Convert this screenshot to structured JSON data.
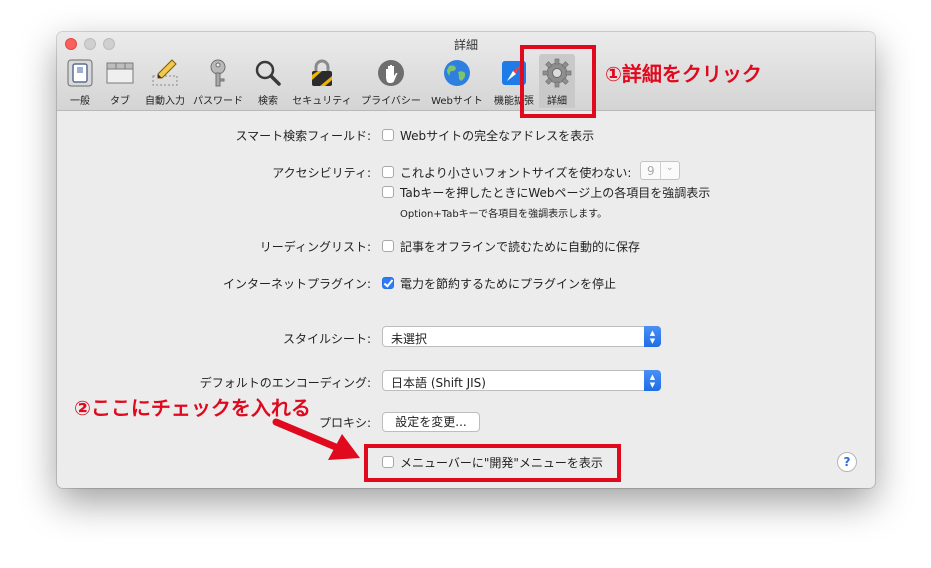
{
  "window": {
    "title": "詳細"
  },
  "toolbar": {
    "items": [
      {
        "label": "一般",
        "icon": "general-switch-icon"
      },
      {
        "label": "タブ",
        "icon": "tabs-icon"
      },
      {
        "label": "自動入力",
        "icon": "pencil-form-icon"
      },
      {
        "label": "パスワード",
        "icon": "key-icon"
      },
      {
        "label": "検索",
        "icon": "magnifier-icon"
      },
      {
        "label": "セキュリティ",
        "icon": "padlock-icon"
      },
      {
        "label": "プライバシー",
        "icon": "hand-icon"
      },
      {
        "label": "Webサイト",
        "icon": "globe-icon"
      },
      {
        "label": "機能拡張",
        "icon": "compass-puzzle-icon"
      },
      {
        "label": "詳細",
        "icon": "gear-icon",
        "selected": true
      }
    ]
  },
  "settings": {
    "smart_search": {
      "label": "スマート検索フィールド:",
      "option": "Webサイトの完全なアドレスを表示",
      "checked": false
    },
    "accessibility": {
      "label": "アクセシビリティ:",
      "option1": "これより小さいフォントサイズを使わない:",
      "option1_checked": false,
      "font_size": "9",
      "option2": "Tabキーを押したときにWebページ上の各項目を強調表示",
      "option2_checked": false,
      "note": "Option+Tabキーで各項目を強調表示します。"
    },
    "reading_list": {
      "label": "リーディングリスト:",
      "option": "記事をオフラインで読むために自動的に保存",
      "checked": false
    },
    "plugins": {
      "label": "インターネットプラグイン:",
      "option": "電力を節約するためにプラグインを停止",
      "checked": true
    },
    "stylesheet": {
      "label": "スタイルシート:",
      "value": "未選択"
    },
    "encoding": {
      "label": "デフォルトのエンコーディング:",
      "value": "日本語 (Shift JIS)"
    },
    "proxy": {
      "label": "プロキシ:",
      "button": "設定を変更..."
    },
    "develop_menu": {
      "option": "メニューバーに\"開発\"メニューを表示",
      "checked": false
    }
  },
  "help_button": "?",
  "annotations": {
    "step1": "①詳細をクリック",
    "step2": "②ここにチェックを入れる",
    "color": "#e0091e"
  },
  "colors": {
    "accent": "#2d7cf6",
    "close_button": "#fc605c"
  }
}
